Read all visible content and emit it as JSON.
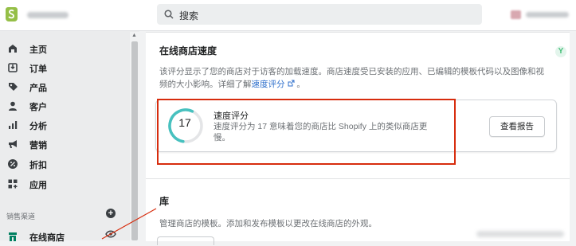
{
  "header": {
    "search_placeholder": "搜索"
  },
  "sidebar": {
    "items": [
      {
        "label": "主页",
        "icon": "home-icon"
      },
      {
        "label": "订单",
        "icon": "orders-icon"
      },
      {
        "label": "产品",
        "icon": "tag-icon"
      },
      {
        "label": "客户",
        "icon": "person-icon"
      },
      {
        "label": "分析",
        "icon": "bar-chart-icon"
      },
      {
        "label": "营销",
        "icon": "megaphone-icon"
      },
      {
        "label": "折扣",
        "icon": "discount-icon"
      },
      {
        "label": "应用",
        "icon": "apps-icon"
      }
    ],
    "sales_channels_label": "销售渠道",
    "online_store_label": "在线商店"
  },
  "speed": {
    "title": "在线商店速度",
    "description": "该评分显示了您的商店对于访客的加载速度。商店速度受已安装的应用、已编辑的模板代码以及图像和视频的大小影响。详细了解",
    "link_text": "速度评分",
    "score": "17",
    "score_value": 17,
    "score_max": 100,
    "score_title": "速度评分",
    "score_text": "速度评分为 17 意味着您的商店比 Shopify 上的类似商店更慢。",
    "report_button": "查看报告"
  },
  "library": {
    "title": "库",
    "description": "管理商店的模板。添加和发布模板以更改在线商店的外观。"
  },
  "colors": {
    "accent": "#2c6ecb",
    "highlight": "#d72c0d",
    "gauge": "#47c1bf",
    "brand": "#95bf47"
  }
}
